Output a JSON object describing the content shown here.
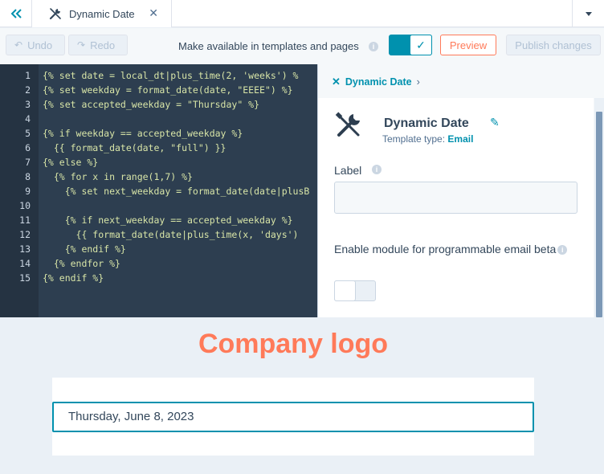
{
  "tab": {
    "label": "Dynamic Date"
  },
  "toolbar": {
    "undo": "Undo",
    "redo": "Redo",
    "availability_label": "Make available in templates and pages",
    "preview": "Preview",
    "publish": "Publish changes",
    "availability_enabled": true
  },
  "editor": {
    "lines": [
      {
        "n": "1",
        "text": "{% set date = local_dt|plus_time(2, 'weeks') %"
      },
      {
        "n": "2",
        "text": "{% set weekday = format_date(date, \"EEEE\") %}"
      },
      {
        "n": "3",
        "text": "{% set accepted_weekday = \"Thursday\" %}"
      },
      {
        "n": "4",
        "text": ""
      },
      {
        "n": "5",
        "text": "{% if weekday == accepted_weekday %}"
      },
      {
        "n": "6",
        "text": "  {{ format_date(date, \"full\") }}"
      },
      {
        "n": "7",
        "text": "{% else %}"
      },
      {
        "n": "8",
        "text": "  {% for x in range(1,7) %}"
      },
      {
        "n": "9",
        "text": "    {% set next_weekday = format_date(date|plusB"
      },
      {
        "n": "10",
        "text": ""
      },
      {
        "n": "11",
        "text": "    {% if next_weekday == accepted_weekday %}"
      },
      {
        "n": "12",
        "text": "      {{ format_date(date|plus_time(x, 'days')"
      },
      {
        "n": "13",
        "text": "    {% endif %}"
      },
      {
        "n": "14",
        "text": "  {% endfor %}"
      },
      {
        "n": "15",
        "text": "{% endif %}"
      }
    ]
  },
  "panel": {
    "breadcrumb": "Dynamic Date",
    "module_name": "Dynamic Date",
    "template_type_label": "Template type:",
    "template_type_value": "Email",
    "label_field_label": "Label",
    "label_field_value": "",
    "enable_label": "Enable module for programmable email beta",
    "programmable_enabled": false
  },
  "preview": {
    "logo_text": "Company logo",
    "date_text": "Thursday, June 8, 2023"
  },
  "colors": {
    "accent": "#0091ae",
    "brand_orange": "#ff7a59",
    "editor_bg": "#2d3e50"
  }
}
